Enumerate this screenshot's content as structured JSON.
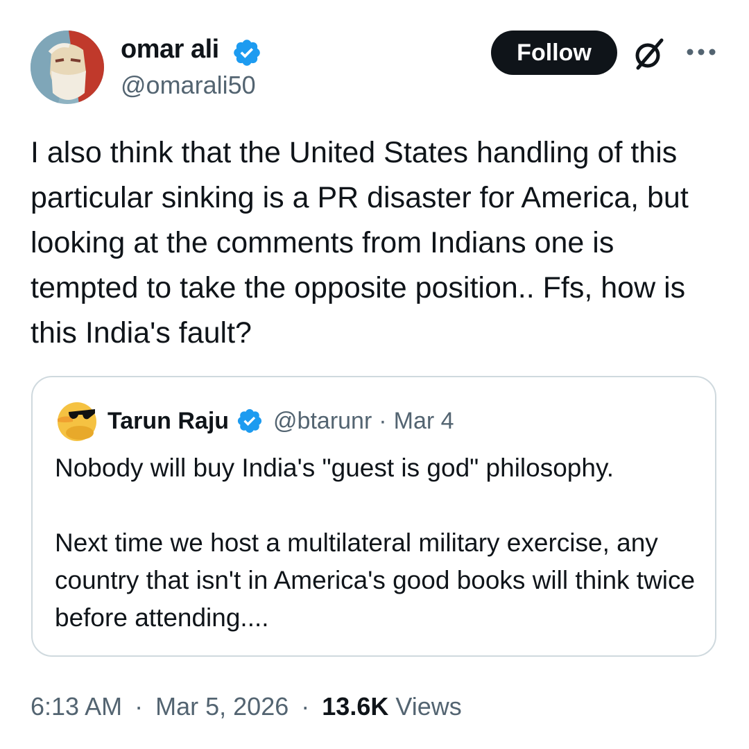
{
  "author": {
    "display_name": "omar ali",
    "handle": "@omarali50",
    "verified_icon": "verified-badge-icon",
    "avatar_icon": "portrait-avatar"
  },
  "actions": {
    "follow_label": "Follow",
    "grok_icon": "grok-icon",
    "more_icon": "more-dots-icon"
  },
  "tweet": {
    "text": "I also think that the United States handling of this particular sinking is a PR disaster for America, but looking at the comments from Indians one is tempted to take the opposite position.. Ffs, how is this India's fault?"
  },
  "quote": {
    "display_name": "Tarun Raju",
    "handle": "@btarunr",
    "separator": "·",
    "date": "Mar 4",
    "paragraphs": [
      "Nobody will buy India's \"guest is god\" philosophy.",
      "Next time we host a multilateral military exercise, any country that isn't in America's good books will think twice before attending...."
    ],
    "avatar_icon": "duck-sunglasses-avatar"
  },
  "footer": {
    "time": "6:13 AM",
    "separator": "·",
    "date": "Mar 5, 2026",
    "views_count": "13.6K",
    "views_label": "Views"
  },
  "colors": {
    "text_primary": "#0f1419",
    "text_secondary": "#536471",
    "border": "#cfd9de",
    "verified_blue": "#1d9bf0",
    "follow_bg": "#0f1419"
  }
}
